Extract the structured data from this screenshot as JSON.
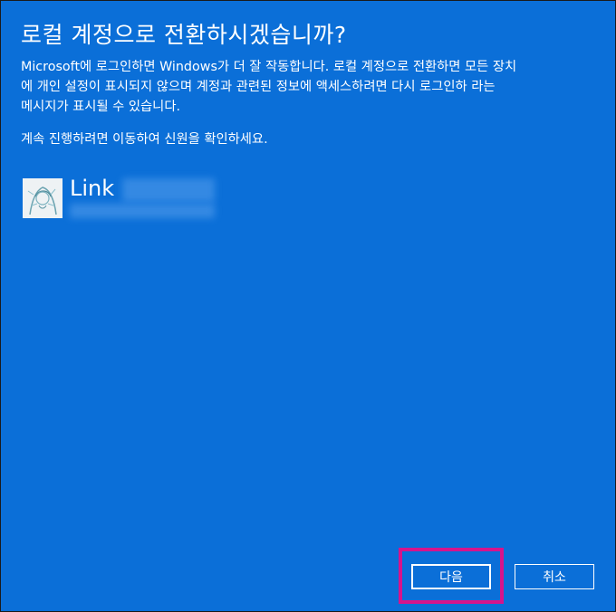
{
  "dialog": {
    "title": "로컬 계정으로 전환하시겠습니까?",
    "description": [
      "Microsoft에 로그인하면 Windows가 더 잘 작동합니다. 로컬 계정으로 전환하면 모든 장치",
      "에 개인 설정이 표시되지 않으며 계정과 관련된 정보에 액세스하려면 다시 로그인하 라는",
      "메시지가 표시될 수 있습니다."
    ],
    "instruction": "계속 진행하려면 이동하여 신원을 확인하세요.",
    "account": {
      "name": "Link",
      "avatar_icon": "user-avatar-icon"
    },
    "buttons": {
      "next_label": "다음",
      "cancel_label": "취소"
    }
  },
  "colors": {
    "background": "#0b6fd8",
    "text": "#ffffff",
    "highlight": "#d6148c"
  }
}
